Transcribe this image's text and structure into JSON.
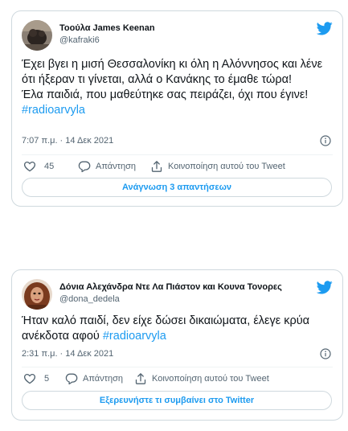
{
  "colors": {
    "accent": "#1d9bf0",
    "text": "#0f1419",
    "muted": "#536471",
    "border": "#cfd9de"
  },
  "tweets": [
    {
      "display_name": "Τοούλα James Keenan",
      "handle": "@kafraki6",
      "body": "Έχει βγει η μισή Θεσσαλονίκη κι όλη η Αλόννησος και λένε ότι ήξεραν τι γίνεται, αλλά ο Κανάκης το έμαθε τώρα!\nΈλα παιδιά, που μαθεύτηκε σας πειράζει, όχι που έγινε!",
      "hashtag": "#radioarvyla",
      "timestamp": "7:07 π.μ. · 14 Δεκ 2021",
      "like_count": "45",
      "reply_label": "Απάντηση",
      "share_label": "Κοινοποίηση αυτού του Tweet",
      "cta_label": "Ανάγνωση 3 απαντήσεων",
      "icons": [
        "avatar-image",
        "twitter-bird-icon",
        "info-icon",
        "heart-icon",
        "reply-bubble-icon",
        "share-icon"
      ]
    },
    {
      "display_name": "Δόνια Αλεχάνδρα Ντε Λα Πιάστον και Κουνα Τονορες",
      "handle": "@dona_dedela",
      "body": "Ήταν καλό παιδί, δεν είχε δώσει δικαιώματα, έλεγε κρύα ανέκδοτα αφού",
      "hashtag": "#radioarvyla",
      "timestamp": "2:31 π.μ. · 14 Δεκ 2021",
      "like_count": "5",
      "reply_label": "Απάντηση",
      "share_label": "Κοινοποίηση αυτού του Tweet",
      "cta_label": "Εξερευνήστε τι συμβαίνει στο Twitter",
      "icons": [
        "avatar-image",
        "twitter-bird-icon",
        "info-icon",
        "heart-icon",
        "reply-bubble-icon",
        "share-icon"
      ]
    }
  ]
}
